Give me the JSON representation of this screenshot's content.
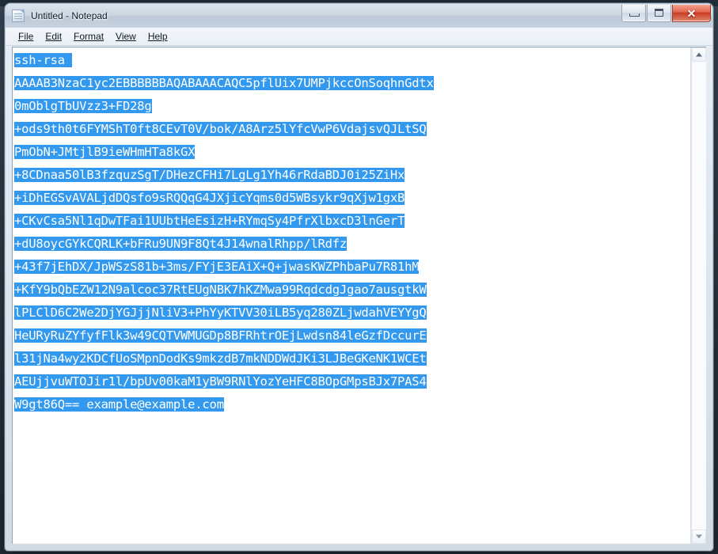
{
  "window": {
    "title": "Untitled - Notepad",
    "icon": "notepad-document-icon",
    "controls": {
      "minimize_label": "—",
      "maximize_label": "□",
      "close_label": "✕"
    }
  },
  "menu": {
    "items": [
      {
        "label": "File",
        "accel": "F"
      },
      {
        "label": "Edit",
        "accel": "E"
      },
      {
        "label": "Format",
        "accel": "o"
      },
      {
        "label": "View",
        "accel": "V"
      },
      {
        "label": "Help",
        "accel": "H"
      }
    ]
  },
  "editor": {
    "selection_color": "#3399ee",
    "selection_text_color": "#ffffff",
    "all_selected": true,
    "lines": [
      "ssh-rsa ",
      "AAAAB3NzaC1yc2EBBBBBBAQABAAACAQC5pflUix7UMPjkccOnSoqhnGdtx",
      "0mOblgTbUVzz3+FD28g",
      "+ods9th0t6FYMShT0ft8CEvT0V/bok/A8Arz5lYfcVwP6VdajsvQJLtSQ",
      "PmObN+JMtjlB9ieWHmHTa8kGX",
      "+8CDnaa50lB3fzquzSgT/DHezCFHi7LgLg1Yh46rRdaBDJ0i25ZiHx",
      "+iDhEGSvAVALjdDQsfo9sRQQqG4JXjicYqms0d5WBsykr9qXjw1gxB",
      "+CKvCsa5Nl1qDwTFai1UUbtHeEsizH+RYmqSy4PfrXlbxcD3lnGerT",
      "+dU8oycGYkCQRLK+bFRu9UN9F8Qt4J14wnalRhpp/lRdfz",
      "+43f7jEhDX/JpWSzS81b+3ms/FYjE3EAiX+Q+jwasKWZPhbaPu7R81hM",
      "+KfY9bQbEZW12N9alcoc37RtEUgNBK7hKZMwa99RqdcdgJgao7ausgtkW",
      "lPLClD6C2We2DjYGJjjNliV3+PhYyKTVV30iLB5yq280ZLjwdahVEYYgQ",
      "HeURyRuZYfyfFlk3w49CQTVWMUGDp8BFRhtrOEjLwdsn84leGzfDccurE",
      "l31jNa4wy2KDCfUoSMpnDodKs9mkzdB7mkNDDWdJKi3LJBeGKeNK1WCEt",
      "AEUjjvuWTOJir1l/bpUv00kaM1yBW9RNlYozYeHFC8BOpGMpsBJx7PAS4",
      "W9gt86Q== example@example.com"
    ]
  },
  "scrollbar": {
    "up_arrow": "scroll-up-arrow-icon",
    "down_arrow": "scroll-down-arrow-icon"
  }
}
